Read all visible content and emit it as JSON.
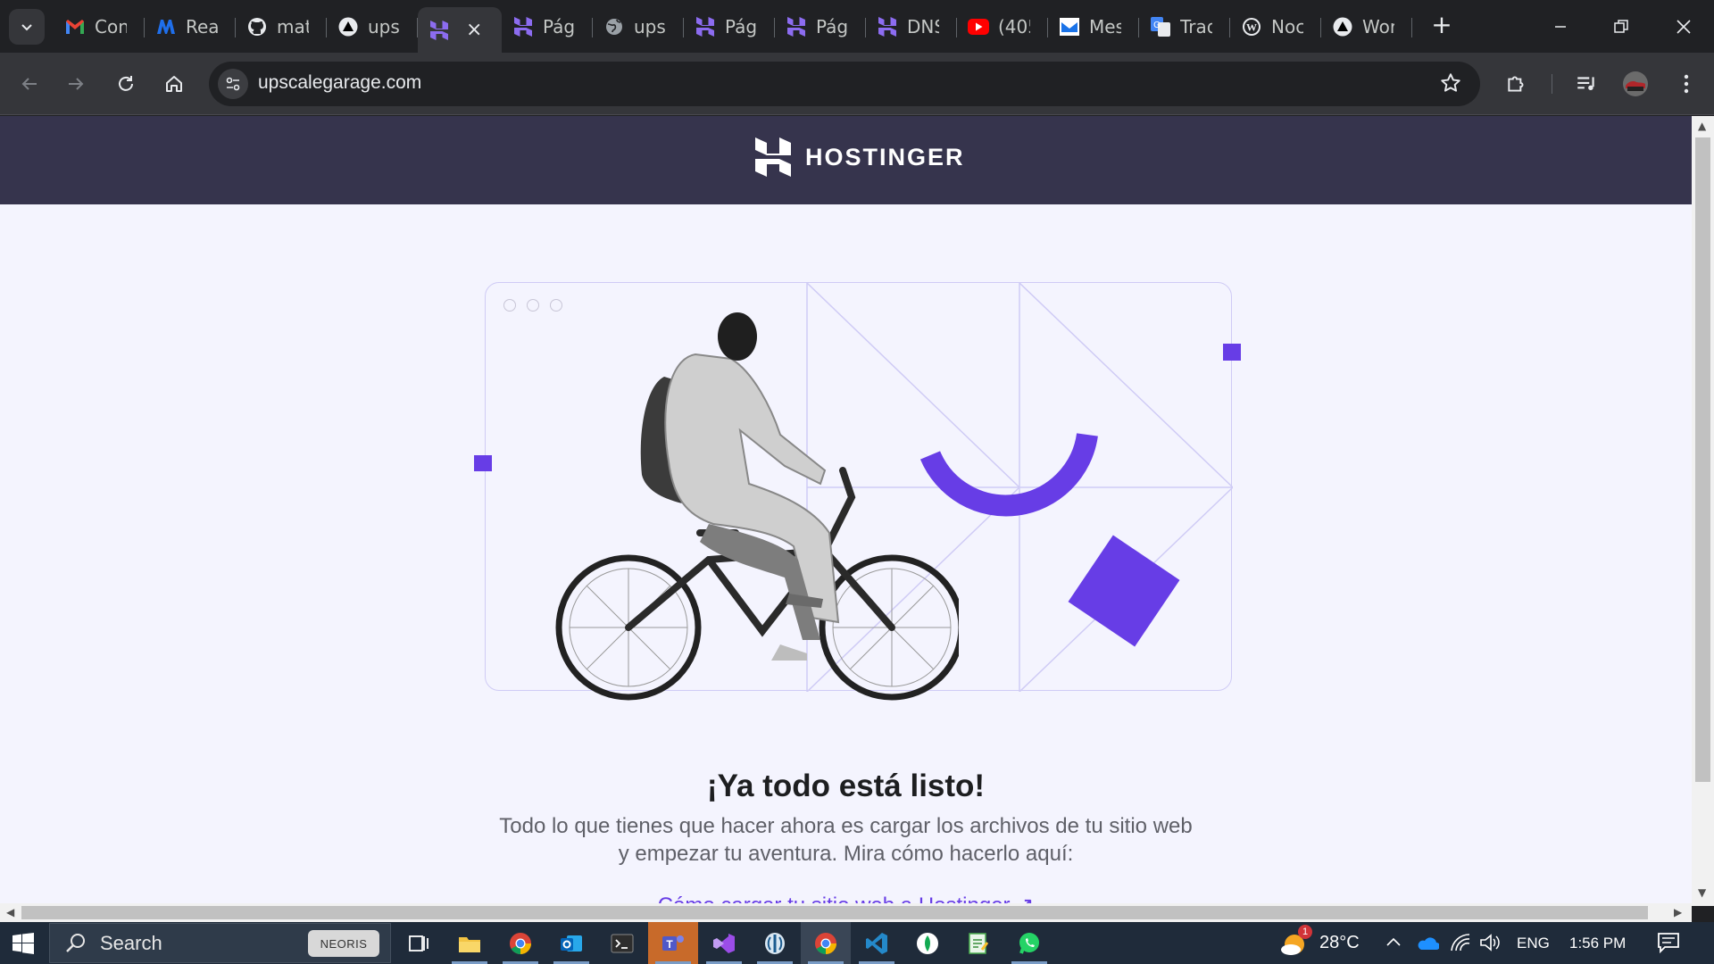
{
  "browser": {
    "tabs": [
      {
        "title": "Con",
        "icon": "gmail-icon"
      },
      {
        "title": "Rea",
        "icon": "m-logo-icon"
      },
      {
        "title": "mat",
        "icon": "github-icon"
      },
      {
        "title": "ups",
        "icon": "triangle-logo-icon"
      },
      {
        "title": "",
        "icon": "hostinger-icon",
        "active": true,
        "close": "×"
      },
      {
        "title": "Pág",
        "icon": "hostinger-icon"
      },
      {
        "title": "ups",
        "icon": "globe-icon"
      },
      {
        "title": "Pág",
        "icon": "hostinger-icon"
      },
      {
        "title": "Pág",
        "icon": "hostinger-icon"
      },
      {
        "title": "DNS",
        "icon": "hostinger-icon"
      },
      {
        "title": "(405",
        "icon": "youtube-icon"
      },
      {
        "title": "Mes",
        "icon": "message-icon"
      },
      {
        "title": "Trad",
        "icon": "google-translate-icon"
      },
      {
        "title": "Noc",
        "icon": "wordpress-icon"
      },
      {
        "title": "Wor",
        "icon": "triangle-logo-icon"
      }
    ],
    "new_tab": "+",
    "url": "upscalegarage.com"
  },
  "page": {
    "brand": "HOSTINGER",
    "headline": "¡Ya todo está listo!",
    "subtext_line1": "Todo lo que tienes que hacer ahora es cargar los archivos de tu sitio web",
    "subtext_line2": "y empezar tu aventura. Mira cómo hacerlo aquí:",
    "help_link": "Cómo cargar tu sitio web a Hostinger ↗"
  },
  "taskbar": {
    "search_text": "Search",
    "search_badge": "NEORIS",
    "weather": "28°C",
    "weather_badge": "1",
    "language": "ENG",
    "time": "1:56 PM"
  },
  "colors": {
    "accent": "#673de6",
    "header_bg": "#36344d",
    "page_bg": "#f4f4fe"
  }
}
